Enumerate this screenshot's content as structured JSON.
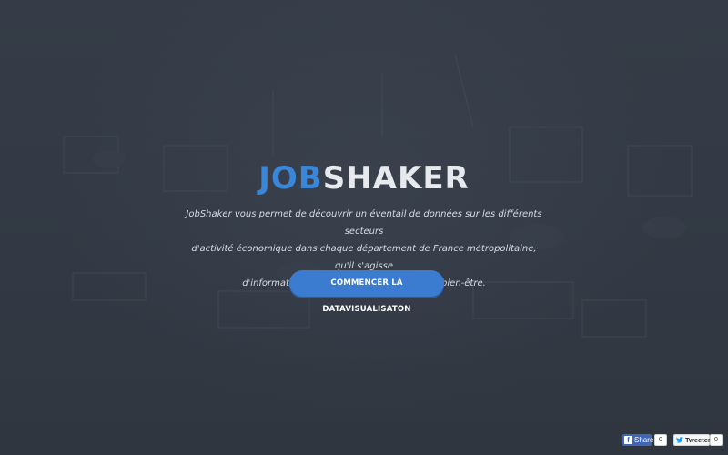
{
  "brand": {
    "part1": "JOB",
    "part2": "SHAKER",
    "part1_color": "#3a86d8",
    "part2_color": "#e6e9ee"
  },
  "intro": {
    "line1": "JobShaker vous permet de découvrir un éventail de données sur les différents secteurs",
    "line2": "d'activité économique dans chaque département de France métropolitaine, qu'il s'agisse",
    "line3": "d'informations sur l'emploi, la société ou le bien-être."
  },
  "cta": {
    "label": "COMMENCER LA DATAVISUALISATON",
    "color": "#3b7bd0"
  },
  "social": {
    "facebook": {
      "icon": "facebook-icon",
      "label": "Share",
      "count": "0"
    },
    "twitter": {
      "icon": "twitter-icon",
      "label": "Tweeter",
      "count": "0"
    }
  },
  "colors": {
    "background": "#333a45"
  }
}
